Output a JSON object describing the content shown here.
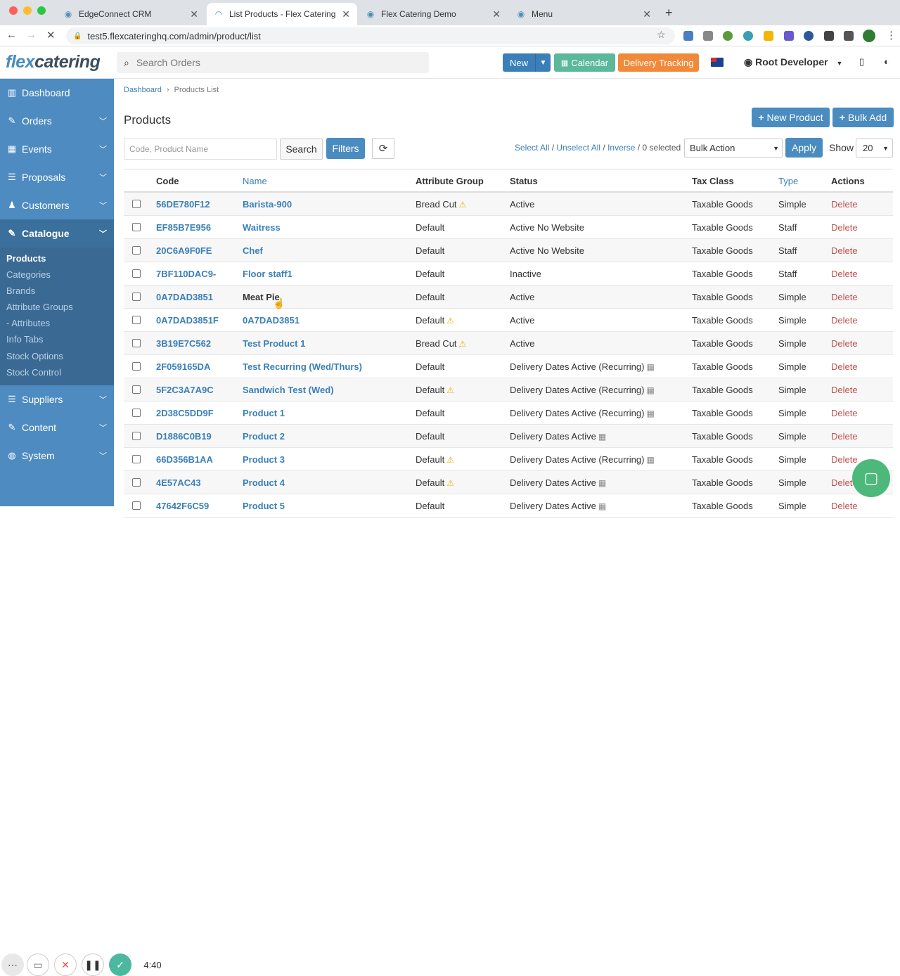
{
  "browser": {
    "tabs": [
      {
        "title": "EdgeConnect CRM",
        "icon": "edge-icon"
      },
      {
        "title": "List Products - Flex Catering",
        "icon": "loading-icon",
        "active": true
      },
      {
        "title": "Flex Catering Demo",
        "icon": "edge-icon"
      },
      {
        "title": "Menu",
        "icon": "edge-icon"
      }
    ],
    "url": "test5.flexcateringhq.com/admin/product/list"
  },
  "header": {
    "logo_flex": "flex",
    "logo_catering": "catering",
    "search_placeholder": "Search Orders",
    "new_label": "New",
    "calendar_label": "Calendar",
    "delivery_label": "Delivery Tracking",
    "user_name": "Root Developer"
  },
  "sidebar": {
    "items": [
      {
        "label": "Dashboard",
        "icon": "chart-icon"
      },
      {
        "label": "Orders",
        "icon": "edit-icon"
      },
      {
        "label": "Events",
        "icon": "calendar-icon"
      },
      {
        "label": "Proposals",
        "icon": "list-icon"
      },
      {
        "label": "Customers",
        "icon": "users-icon"
      },
      {
        "label": "Catalogue",
        "icon": "book-icon",
        "active": true
      },
      {
        "label": "Suppliers",
        "icon": "list-icon"
      },
      {
        "label": "Content",
        "icon": "edit-icon"
      },
      {
        "label": "System",
        "icon": "globe-icon"
      }
    ],
    "submenu": [
      "Products",
      "Categories",
      "Brands",
      "Attribute Groups",
      "- Attributes",
      "Info Tabs",
      "Stock Options",
      "Stock Control"
    ]
  },
  "main": {
    "breadcrumb": {
      "home": "Dashboard",
      "current": "Products List"
    },
    "title": "Products",
    "new_product_label": "New Product",
    "bulk_add_label": "Bulk Add",
    "filter_placeholder": "Code, Product Name",
    "search_label": "Search",
    "filters_label": "Filters",
    "select_all": "Select All",
    "unselect_all": "Unselect All",
    "inverse": "Inverse",
    "selected_count": "0 selected",
    "bulk_action": "Bulk Action",
    "apply_label": "Apply",
    "show_label": "Show",
    "show_value": "20"
  },
  "table": {
    "headers": [
      "Code",
      "Name",
      "Attribute Group",
      "Status",
      "Tax Class",
      "Type",
      "Actions"
    ],
    "rows": [
      {
        "code": "56DE780F12",
        "name": "Barista-900",
        "attr": "Bread Cut",
        "warn": true,
        "status": "Active",
        "cal": false,
        "tax": "Taxable Goods",
        "type": "Simple",
        "action": "Delete"
      },
      {
        "code": "EF85B7E956",
        "name": "Waitress",
        "attr": "Default",
        "warn": false,
        "status": "Active No Website",
        "cal": false,
        "tax": "Taxable Goods",
        "type": "Staff",
        "action": "Delete"
      },
      {
        "code": "20C6A9F0FE",
        "name": "Chef",
        "attr": "Default",
        "warn": false,
        "status": "Active No Website",
        "cal": false,
        "tax": "Taxable Goods",
        "type": "Staff",
        "action": "Delete"
      },
      {
        "code": "7BF110DAC9-",
        "name": "Floor staff1",
        "attr": "Default",
        "warn": false,
        "status": "Inactive",
        "cal": false,
        "tax": "Taxable Goods",
        "type": "Staff",
        "action": "Delete"
      },
      {
        "code": "0A7DAD3851",
        "name": "Meat Pie",
        "attr": "Default",
        "warn": false,
        "status": "Active",
        "cal": false,
        "tax": "Taxable Goods",
        "type": "Simple",
        "action": "Delete",
        "hover": true
      },
      {
        "code": "0A7DAD3851F",
        "name": "0A7DAD3851",
        "attr": "Default",
        "warn": true,
        "status": "Active",
        "cal": false,
        "tax": "Taxable Goods",
        "type": "Simple",
        "action": "Delete"
      },
      {
        "code": "3B19E7C562",
        "name": "Test Product 1",
        "attr": "Bread Cut",
        "warn": true,
        "status": "Active",
        "cal": false,
        "tax": "Taxable Goods",
        "type": "Simple",
        "action": "Delete"
      },
      {
        "code": "2F059165DA",
        "name": "Test Recurring (Wed/Thurs)",
        "attr": "Default",
        "warn": false,
        "status": "Delivery Dates Active (Recurring)",
        "cal": true,
        "tax": "Taxable Goods",
        "type": "Simple",
        "action": "Delete"
      },
      {
        "code": "5F2C3A7A9C",
        "name": "Sandwich Test (Wed)",
        "attr": "Default",
        "warn": true,
        "status": "Delivery Dates Active (Recurring)",
        "cal": true,
        "tax": "Taxable Goods",
        "type": "Simple",
        "action": "Delete"
      },
      {
        "code": "2D38C5DD9F",
        "name": "Product 1",
        "attr": "Default",
        "warn": false,
        "status": "Delivery Dates Active (Recurring)",
        "cal": true,
        "tax": "Taxable Goods",
        "type": "Simple",
        "action": "Delete"
      },
      {
        "code": "D1886C0B19",
        "name": "Product 2",
        "attr": "Default",
        "warn": false,
        "status": "Delivery Dates Active",
        "cal": true,
        "tax": "Taxable Goods",
        "type": "Simple",
        "action": "Delete"
      },
      {
        "code": "66D356B1AA",
        "name": "Product 3",
        "attr": "Default",
        "warn": true,
        "status": "Delivery Dates Active (Recurring)",
        "cal": true,
        "tax": "Taxable Goods",
        "type": "Simple",
        "action": "Delete"
      },
      {
        "code": "4E57AC43",
        "name": "Product 4",
        "attr": "Default",
        "warn": true,
        "status": "Delivery Dates Active",
        "cal": true,
        "tax": "Taxable Goods",
        "type": "Simple",
        "action": "Delete"
      },
      {
        "code": "47642F6C59",
        "name": "Product 5",
        "attr": "Default",
        "warn": false,
        "status": "Delivery Dates Active",
        "cal": true,
        "tax": "Taxable Goods",
        "type": "Simple",
        "action": "Delete"
      }
    ]
  },
  "recorder": {
    "time": "4:40"
  },
  "colors": {
    "primary": "#4a8bc0",
    "sidebar": "#4e8bc0",
    "calendar": "#5cb89a",
    "delivery": "#f08a3a",
    "delete": "#c0504d",
    "chat": "#4cb87a"
  }
}
